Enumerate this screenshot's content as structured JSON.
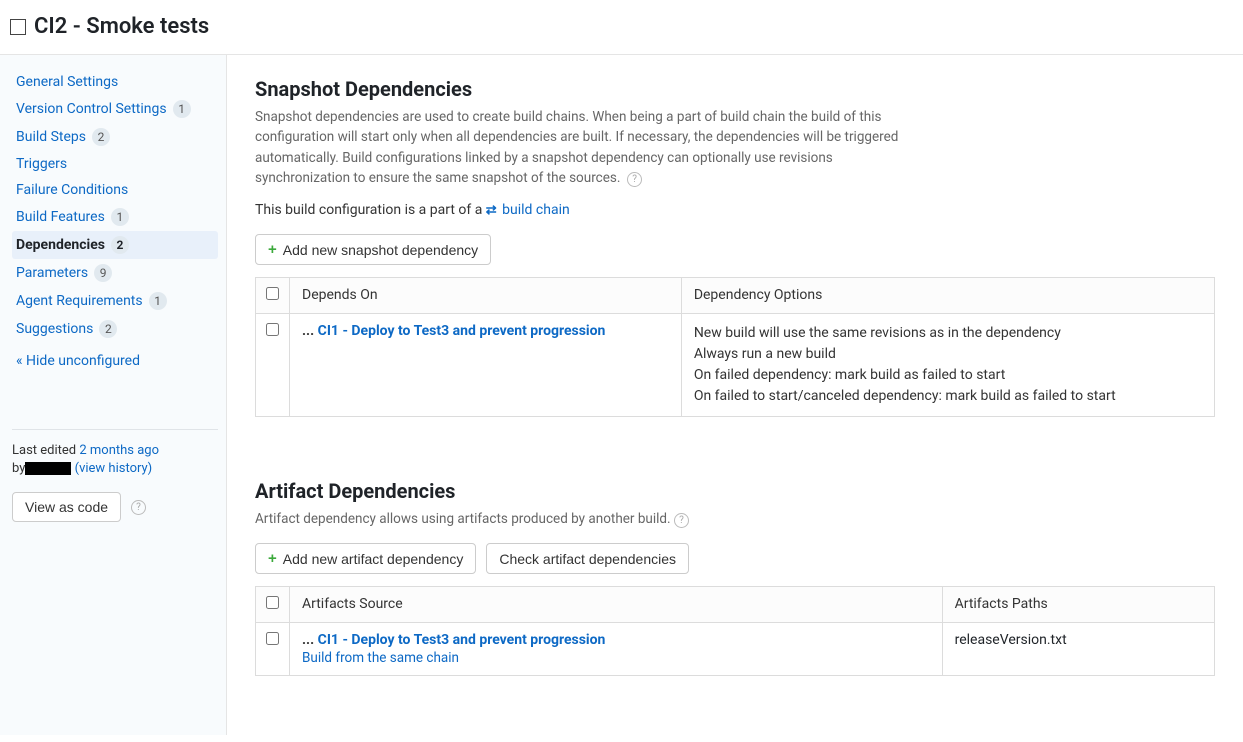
{
  "header": {
    "title": "CI2 - Smoke tests"
  },
  "sidebar": {
    "items": [
      {
        "label": "General Settings",
        "badge": ""
      },
      {
        "label": "Version Control Settings",
        "badge": "1"
      },
      {
        "label": "Build Steps",
        "badge": "2"
      },
      {
        "label": "Triggers",
        "badge": ""
      },
      {
        "label": "Failure Conditions",
        "badge": ""
      },
      {
        "label": "Build Features",
        "badge": "1"
      },
      {
        "label": "Dependencies",
        "badge": "2"
      },
      {
        "label": "Parameters",
        "badge": "9"
      },
      {
        "label": "Agent Requirements",
        "badge": "1"
      },
      {
        "label": "Suggestions",
        "badge": "2"
      }
    ],
    "hide_unconfigured": "« Hide unconfigured",
    "last_edited_prefix": "Last edited ",
    "last_edited_time": "2 months ago",
    "by_prefix": "by",
    "view_history": "(view history)",
    "view_as_code": "View as code"
  },
  "snapshot": {
    "title": "Snapshot Dependencies",
    "desc": "Snapshot dependencies are used to create build chains. When being a part of build chain the build of this configuration will start only when all dependencies are built. If necessary, the dependencies will be triggered automatically. Build configurations linked by a snapshot dependency can optionally use revisions synchronization to ensure the same snapshot of the sources.",
    "chain_prefix": "This build configuration is a part of a ",
    "chain_link": "build chain",
    "add_btn": "Add new snapshot dependency",
    "col_depends": "Depends On",
    "col_options": "Dependency Options",
    "row_prefix": "... ",
    "row_depends": "CI1 - Deploy to Test3 and prevent progression",
    "opt1": "New build will use the same revisions as in the dependency",
    "opt2": "Always run a new build",
    "opt3": "On failed dependency: mark build as failed to start",
    "opt4": "On failed to start/canceled dependency: mark build as failed to start"
  },
  "artifact": {
    "title": "Artifact Dependencies",
    "desc": "Artifact dependency allows using artifacts produced by another build.",
    "add_btn": "Add new artifact dependency",
    "check_btn": "Check artifact dependencies",
    "col_source": "Artifacts Source",
    "col_paths": "Artifacts Paths",
    "row_prefix": "... ",
    "row_source": "CI1 - Deploy to Test3 and prevent progression",
    "row_sub": "Build from the same chain",
    "row_paths": "releaseVersion.txt"
  }
}
